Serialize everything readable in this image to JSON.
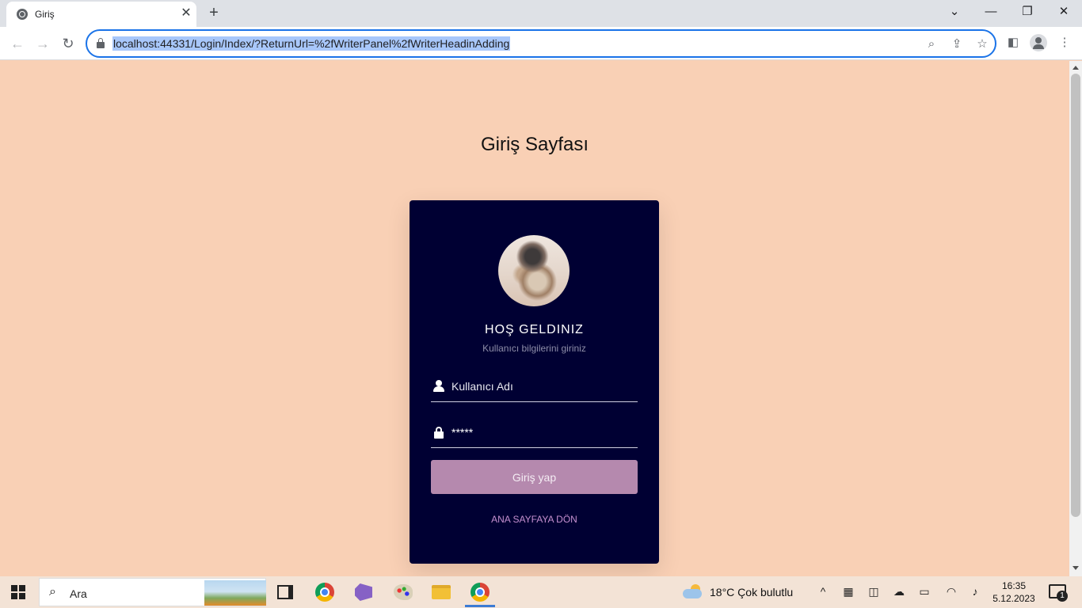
{
  "browser": {
    "tab_title": "Giriş",
    "tab_close": "✕",
    "new_tab": "+",
    "url": "localhost:44331/Login/Index/?ReturnUrl=%2fWriterPanel%2fWriterHeadinAdding"
  },
  "page": {
    "title": "Giriş Sayfası"
  },
  "card": {
    "welcome": "HOŞ GELDINIZ",
    "subtitle": "Kullanıcı bilgilerini giriniz",
    "username_placeholder": "Kullanıcı Adı",
    "username_value": "",
    "password_value": "*****",
    "login_button": "Giriş yap",
    "home_link": "ANA SAYFAYA DÖN"
  },
  "taskbar": {
    "search_placeholder": "Ara",
    "weather": "18°C  Çok bulutlu",
    "time": "16:35",
    "date": "5.12.2023",
    "notification_count": "1"
  },
  "colors": {
    "page_background": "#f9d0b5",
    "card_background": "#000033",
    "button": "#b589ae",
    "link": "#c48fcf"
  },
  "icons": [
    "globe-icon",
    "close-icon",
    "plus-icon",
    "back-icon",
    "forward-icon",
    "reload-icon",
    "lock-icon",
    "zoom-icon",
    "share-icon",
    "star-icon",
    "side-panel-icon",
    "profile-icon",
    "menu-icon",
    "user-icon",
    "password-lock-icon",
    "windows-icon",
    "search-icon"
  ]
}
